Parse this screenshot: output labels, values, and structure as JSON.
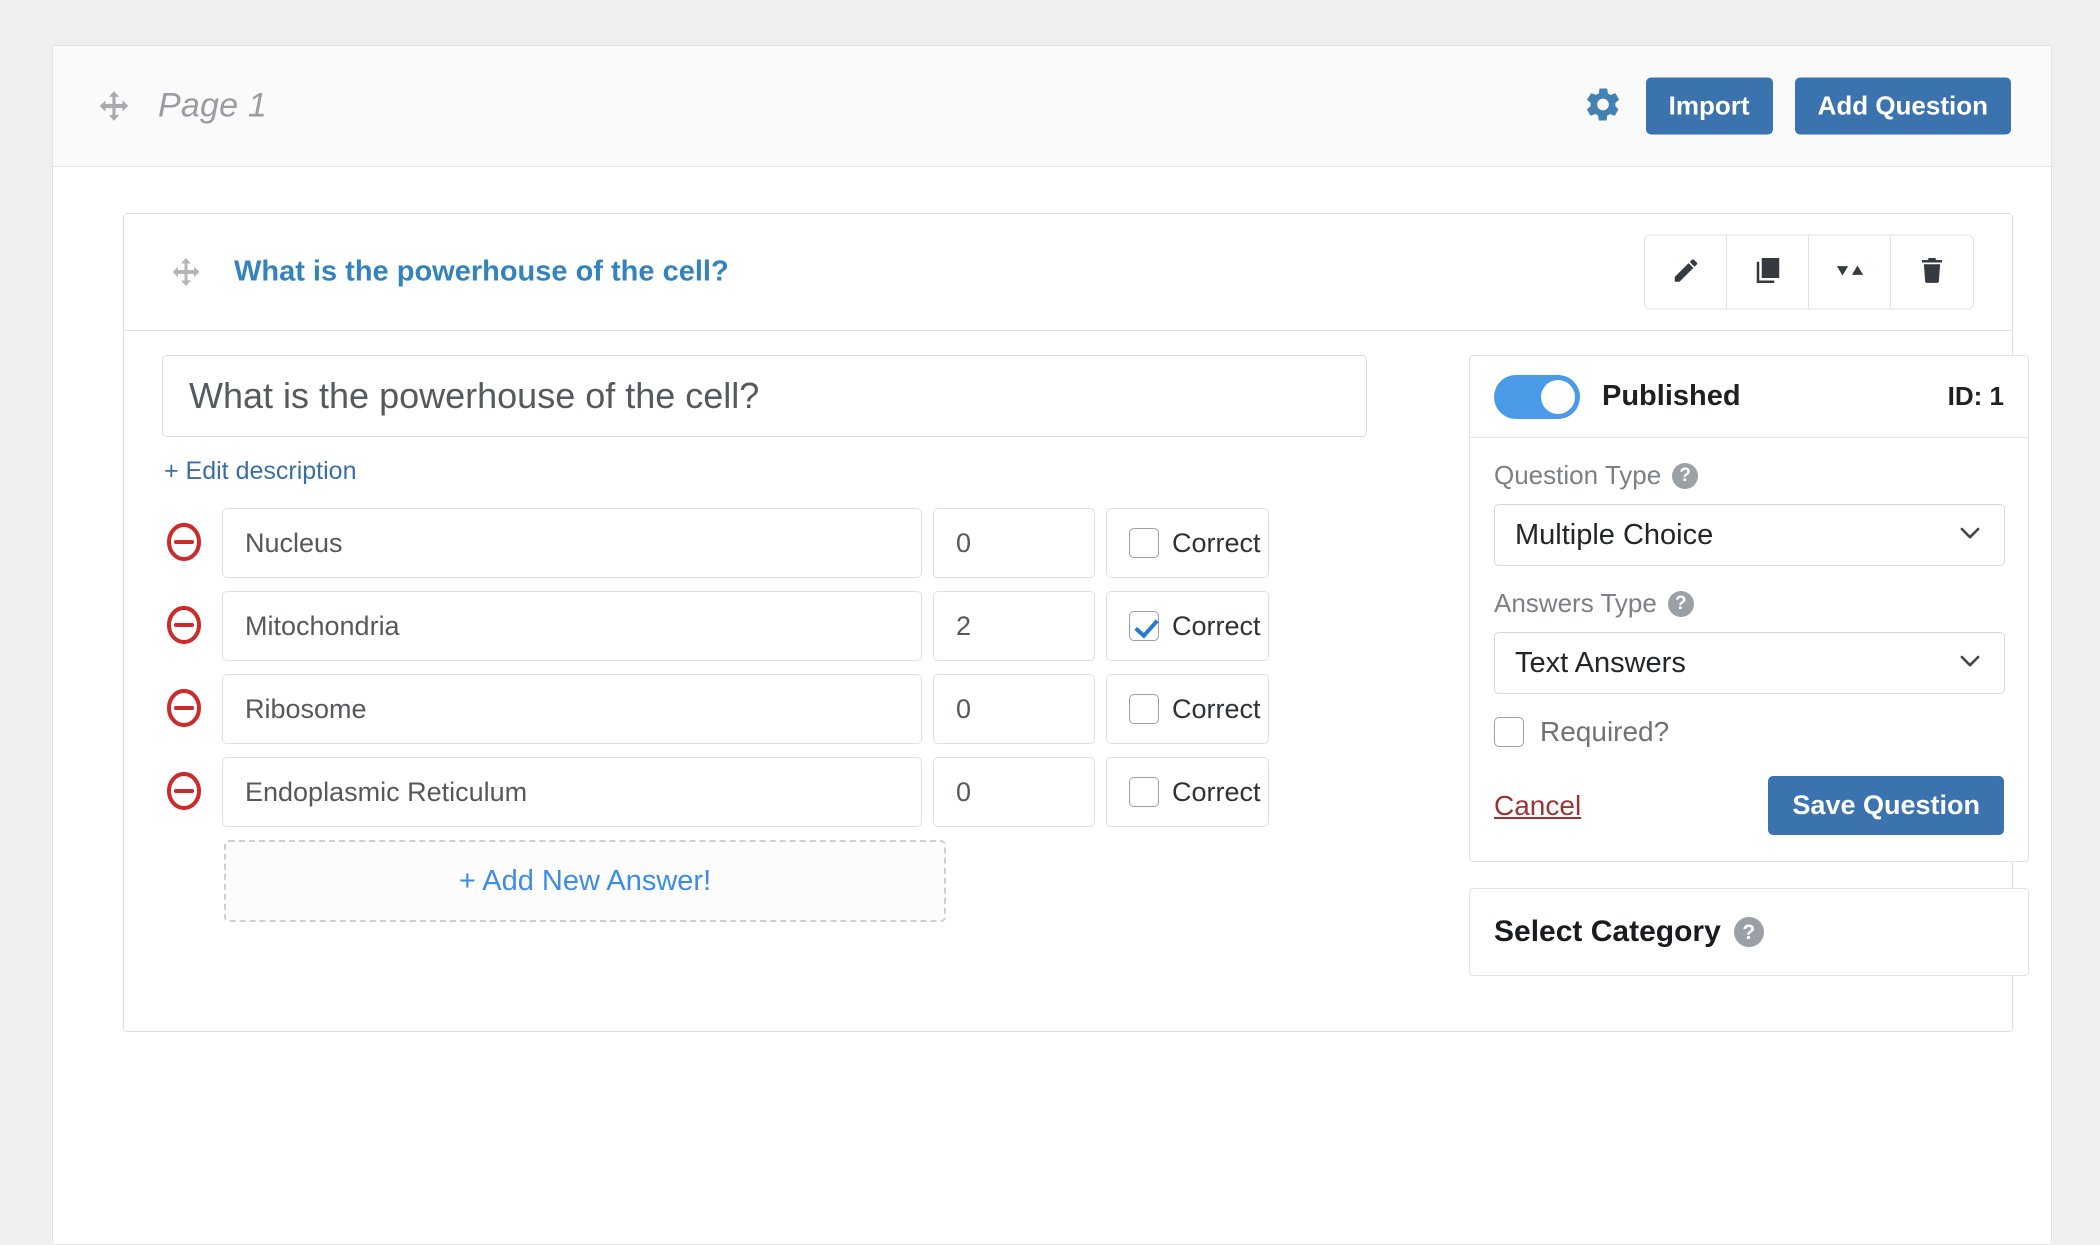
{
  "page": {
    "title": "Page 1",
    "move_icon": "move-icon",
    "gear_icon": "gear-icon",
    "import_label": "Import",
    "add_question_label": "Add Question"
  },
  "question_card": {
    "move_icon": "move-icon",
    "header_title": "What is the powerhouse of the cell?",
    "actions": [
      {
        "name": "edit-question-button",
        "icon": "pencil-icon"
      },
      {
        "name": "duplicate-question-button",
        "icon": "copy-icon"
      },
      {
        "name": "reorder-question-button",
        "icon": "sort-icon"
      },
      {
        "name": "delete-question-button",
        "icon": "trash-icon"
      }
    ],
    "question_input_value": "What is the powerhouse of the cell?",
    "question_input_placeholder": "Question title",
    "edit_description_label": "+ Edit description",
    "answers": [
      {
        "text": "Nucleus",
        "points": "0",
        "correct_label": "Correct",
        "correct": false
      },
      {
        "text": "Mitochondria",
        "points": "2",
        "correct_label": "Correct",
        "correct": true
      },
      {
        "text": "Ribosome",
        "points": "0",
        "correct_label": "Correct",
        "correct": false
      },
      {
        "text": "Endoplasmic Reticulum",
        "points": "0",
        "correct_label": "Correct",
        "correct": false
      }
    ],
    "add_new_answer_label": "+ Add New Answer!"
  },
  "settings": {
    "published_label": "Published",
    "published_on": true,
    "id_label": "ID: 1",
    "question_type_label": "Question Type",
    "question_type_value": "Multiple Choice",
    "answers_type_label": "Answers Type",
    "answers_type_value": "Text Answers",
    "required_label": "Required?",
    "required_checked": false,
    "cancel_label": "Cancel",
    "save_label": "Save Question",
    "help_icon": "help-icon",
    "chevron_icon": "chevron-down-icon"
  },
  "category": {
    "title": "Select Category",
    "help_icon": "help-icon"
  },
  "colors": {
    "accent_blue": "#3b73ae",
    "link_blue": "#3d8ce8",
    "title_blue": "#3383bf",
    "toggle_blue": "#4a9ae8",
    "danger_red": "#cc2b2b",
    "cancel_red": "#9c3434",
    "page_bg": "#efefef"
  }
}
